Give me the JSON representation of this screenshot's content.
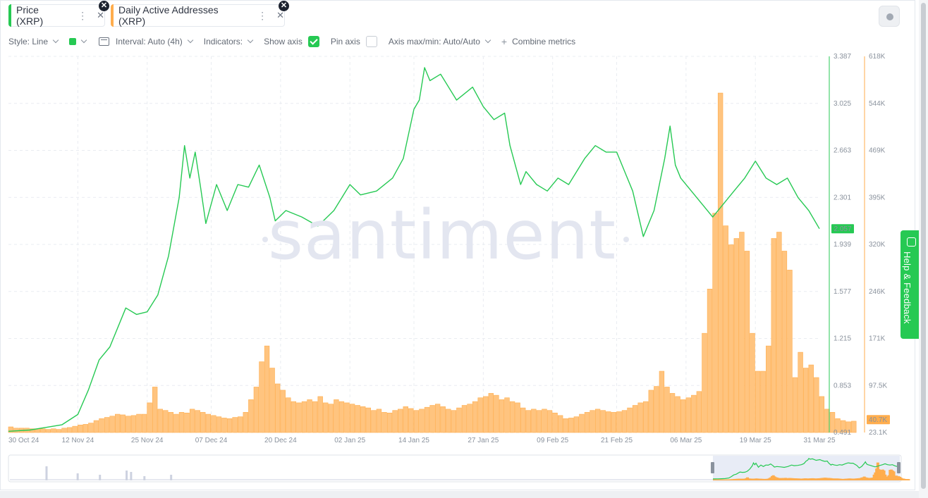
{
  "metrics": [
    {
      "label": "Price (XRP)",
      "color": "#26c953"
    },
    {
      "label": "Daily Active Addresses (XRP)",
      "color": "#ffad4d"
    }
  ],
  "toolbar": {
    "style": "Style: Line",
    "interval": "Interval: Auto (4h)",
    "indicators": "Indicators:",
    "show_axis": "Show axis",
    "show_axis_checked": true,
    "pin_axis": "Pin axis",
    "pin_axis_checked": false,
    "axis_maxmin": "Axis max/min: Auto/Auto",
    "combine": "Combine metrics"
  },
  "watermark": "santiment",
  "help_label": "Help & Feedback",
  "chart_data": {
    "type": "line+bar",
    "x_ticks": [
      "30 Oct 24",
      "12 Nov 24",
      "25 Nov 24",
      "07 Dec 24",
      "20 Dec 24",
      "02 Jan 25",
      "14 Jan 25",
      "27 Jan 25",
      "09 Feb 25",
      "21 Feb 25",
      "06 Mar 25",
      "19 Mar 25",
      "31 Mar 25"
    ],
    "xlim": [
      "2024-10-30",
      "2025-03-31"
    ],
    "price_axis": {
      "ticks": [
        "3.387",
        "3.025",
        "2.663",
        "2.301",
        "1.939",
        "1.577",
        "1.215",
        "0.853",
        "0.491"
      ],
      "ylim": [
        0.491,
        3.387
      ],
      "color": "#26c953",
      "current": "2.057"
    },
    "addresses_axis": {
      "ticks": [
        "618K",
        "544K",
        "469K",
        "395K",
        "320K",
        "246K",
        "171K",
        "97.5K",
        "23.1K"
      ],
      "ylim": [
        23100,
        618000
      ],
      "color": "#ffad4d",
      "current": "40.7K"
    },
    "grid": true,
    "series": [
      {
        "name": "Price (XRP)",
        "type": "line",
        "axis": "left",
        "x": [
          "2024-10-30",
          "2024-11-03",
          "2024-11-06",
          "2024-11-09",
          "2024-11-12",
          "2024-11-14",
          "2024-11-16",
          "2024-11-18",
          "2024-11-21",
          "2024-11-23",
          "2024-11-25",
          "2024-11-27",
          "2024-11-29",
          "2024-12-01",
          "2024-12-02",
          "2024-12-03",
          "2024-12-04",
          "2024-12-05",
          "2024-12-06",
          "2024-12-08",
          "2024-12-10",
          "2024-12-12",
          "2024-12-14",
          "2024-12-16",
          "2024-12-18",
          "2024-12-19",
          "2024-12-21",
          "2024-12-24",
          "2024-12-27",
          "2024-12-30",
          "2025-01-02",
          "2025-01-04",
          "2025-01-07",
          "2025-01-10",
          "2025-01-12",
          "2025-01-14",
          "2025-01-15",
          "2025-01-16",
          "2025-01-17",
          "2025-01-19",
          "2025-01-22",
          "2025-01-25",
          "2025-01-27",
          "2025-01-29",
          "2025-01-31",
          "2025-02-01",
          "2025-02-03",
          "2025-02-04",
          "2025-02-06",
          "2025-02-08",
          "2025-02-10",
          "2025-02-12",
          "2025-02-15",
          "2025-02-17",
          "2025-02-19",
          "2025-02-21",
          "2025-02-24",
          "2025-02-26",
          "2025-02-28",
          "2025-03-02",
          "2025-03-03",
          "2025-03-04",
          "2025-03-05",
          "2025-03-07",
          "2025-03-09",
          "2025-03-11",
          "2025-03-13",
          "2025-03-15",
          "2025-03-17",
          "2025-03-19",
          "2025-03-21",
          "2025-03-23",
          "2025-03-25",
          "2025-03-27",
          "2025-03-29",
          "2025-03-31"
        ],
        "values": [
          0.5,
          0.51,
          0.53,
          0.55,
          0.63,
          0.82,
          1.05,
          1.15,
          1.45,
          1.4,
          1.42,
          1.55,
          1.85,
          2.3,
          2.7,
          2.45,
          2.65,
          2.38,
          2.1,
          2.4,
          2.2,
          2.4,
          2.38,
          2.55,
          2.3,
          2.12,
          2.2,
          2.15,
          2.08,
          2.2,
          2.4,
          2.32,
          2.35,
          2.45,
          2.6,
          2.98,
          3.05,
          3.3,
          3.2,
          3.25,
          3.05,
          3.15,
          3.0,
          2.9,
          2.95,
          2.7,
          2.4,
          2.5,
          2.4,
          2.35,
          2.45,
          2.4,
          2.6,
          2.7,
          2.65,
          2.65,
          2.35,
          2.0,
          2.2,
          2.6,
          2.85,
          2.55,
          2.45,
          2.35,
          2.25,
          2.15,
          2.25,
          2.35,
          2.45,
          2.58,
          2.45,
          2.4,
          2.45,
          2.3,
          2.2,
          2.06
        ]
      },
      {
        "name": "Daily Active Addresses (XRP)",
        "type": "bar",
        "axis": "right",
        "x_start": "2024-10-30",
        "interval_days": 1,
        "values": [
          32000,
          30000,
          30000,
          30000,
          29000,
          29000,
          29000,
          28000,
          29000,
          28000,
          30000,
          31000,
          33000,
          35000,
          36000,
          38000,
          42000,
          45000,
          47000,
          49000,
          52000,
          51000,
          49000,
          50000,
          52000,
          52000,
          70000,
          95000,
          60000,
          58000,
          55000,
          52000,
          55000,
          54000,
          60000,
          58000,
          55000,
          52000,
          50000,
          48000,
          46000,
          45000,
          47000,
          48000,
          55000,
          75000,
          95000,
          135000,
          160000,
          125000,
          100000,
          90000,
          78000,
          72000,
          70000,
          72000,
          75000,
          72000,
          80000,
          70000,
          68000,
          75000,
          72000,
          70000,
          68000,
          66000,
          64000,
          62000,
          58000,
          60000,
          55000,
          54000,
          58000,
          60000,
          64000,
          61000,
          58000,
          60000,
          63000,
          66000,
          68000,
          64000,
          60000,
          58000,
          62000,
          66000,
          68000,
          72000,
          78000,
          80000,
          85000,
          82000,
          75000,
          78000,
          72000,
          70000,
          62000,
          58000,
          60000,
          58000,
          60000,
          58000,
          54000,
          50000,
          45000,
          46000,
          48000,
          52000,
          55000,
          58000,
          60000,
          58000,
          56000,
          55000,
          56000,
          58000,
          62000,
          66000,
          70000,
          72000,
          90000,
          96000,
          120000,
          95000,
          85000,
          80000,
          75000,
          78000,
          82000,
          88000,
          180000,
          250000,
          370000,
          560000,
          350000,
          320000,
          330000,
          340000,
          310000,
          180000,
          120000,
          120000,
          160000,
          330000,
          340000,
          310000,
          280000,
          110000,
          150000,
          125000,
          130000,
          110000,
          80000,
          60000,
          55000,
          45000,
          42000,
          40000,
          41000
        ]
      }
    ]
  }
}
